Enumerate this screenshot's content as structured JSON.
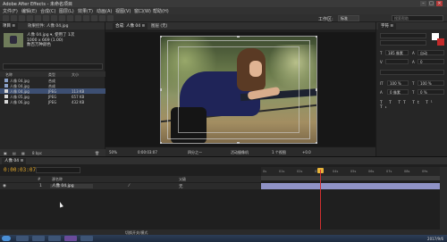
{
  "titlebar": {
    "title": "Adobe After Effects - 未命名项目",
    "buttons": [
      "–",
      "□",
      "×"
    ]
  },
  "menubar": {
    "items": [
      "文件(F)",
      "编辑(E)",
      "合成(C)",
      "图层(L)",
      "效果(T)",
      "动画(A)",
      "视图(V)",
      "窗口(W)",
      "帮助(H)"
    ]
  },
  "toolbar": {
    "workspace_label": "工作区:",
    "workspace_value": "标准",
    "search_placeholder": "搜索帮助"
  },
  "project": {
    "tabs": [
      "项目 ≡",
      "效果控件: 人像 04.jpg"
    ],
    "info": [
      "人像 04.jpg ▾, 使用了 1次",
      "1000 x 669 (1.00)",
      "数百万种颜色"
    ],
    "columns": [
      "名称",
      "类型",
      "大小"
    ],
    "rows": [
      {
        "name": "人像 04.jpg",
        "type": "合成",
        "size": ""
      },
      {
        "name": "人像 04.jpg",
        "type": "合成",
        "size": ""
      },
      {
        "name": "人像 04.jpg",
        "type": "JPEG",
        "size": "113 KB"
      },
      {
        "name": "人像 05.jpg",
        "type": "JPEG",
        "size": "657 KB"
      },
      {
        "name": "人像 06.jpg",
        "type": "JPEG",
        "size": "432 KB"
      }
    ],
    "selected_row": 2,
    "bpc": "8 bpc"
  },
  "comp": {
    "tabs": [
      "合成: 人像 04 ≡",
      "图层 (无)"
    ],
    "footer": [
      "50%",
      "0:00:03:07",
      "四分之一",
      "活动摄像机",
      "1 个视图",
      "+0.0"
    ]
  },
  "character": {
    "tab": "字符 ≡",
    "font_size": "185 像素",
    "leading": "自动",
    "tracking": "0",
    "vertical_scale": "100 %",
    "horizontal_scale": "100 %",
    "baseline": "0 像素",
    "tsume": "0 %"
  },
  "timeline": {
    "tab": "人像 04 ≡",
    "timecode": "0:00:03:07",
    "columns": [
      "#",
      "源名称",
      "父级"
    ],
    "layer": {
      "index": "1",
      "name": "人像 04.jpg",
      "parent": "无"
    },
    "ruler_ticks": [
      "0s",
      "01s",
      "02s",
      "03s",
      "04s",
      "05s",
      "06s",
      "07s",
      "08s",
      "09s"
    ],
    "playhead_fraction": 0.33,
    "bottom_label": "切换开关/模式"
  },
  "taskbar": {
    "tray": "2017/9/6"
  }
}
